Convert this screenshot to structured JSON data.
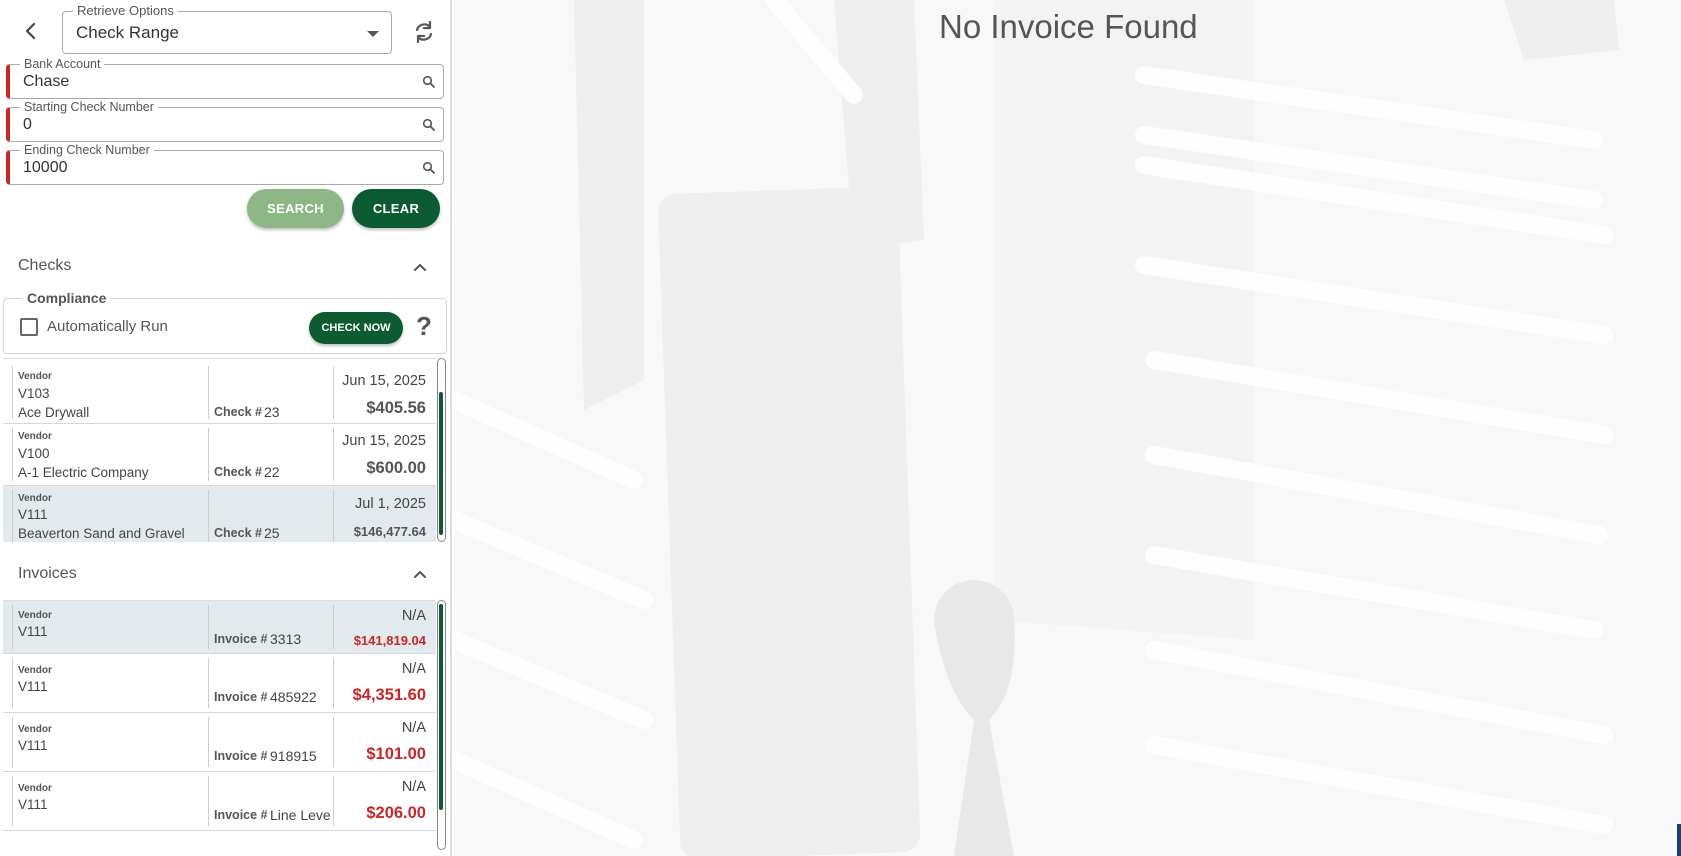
{
  "filters": {
    "retrieve_label": "Retrieve Options",
    "retrieve_value": "Check Range",
    "bank_label": "Bank Account",
    "bank_value": "Chase",
    "start_label": "Starting Check Number",
    "start_value": "0",
    "end_label": "Ending Check Number",
    "end_value": "10000",
    "search_label": "SEARCH",
    "clear_label": "CLEAR"
  },
  "checks": {
    "title": "Checks",
    "compliance": {
      "title": "Compliance",
      "auto_run_label": "Automatically Run",
      "check_now_label": "CHECK NOW",
      "help_glyph": "?"
    },
    "rows": [
      {
        "vendor_label": "Vendor",
        "vendor_code": "V103",
        "vendor_name": "Ace Drywall",
        "num_label": "Check #",
        "num": "23",
        "date": "Jun 15, 2025",
        "amount": "$405.56"
      },
      {
        "vendor_label": "Vendor",
        "vendor_code": "V100",
        "vendor_name": "A-1 Electric Company",
        "num_label": "Check #",
        "num": "22",
        "date": "Jun 15, 2025",
        "amount": "$600.00"
      },
      {
        "vendor_label": "Vendor",
        "vendor_code": "V111",
        "vendor_name": "Beaverton Sand and Gravel",
        "num_label": "Check #",
        "num": "25",
        "date": "Jul 1, 2025",
        "amount": "$146,477.64"
      }
    ]
  },
  "invoices": {
    "title": "Invoices",
    "rows": [
      {
        "vendor_label": "Vendor",
        "vendor_code": "V111",
        "num_label": "Invoice #",
        "num": "3313",
        "date": "N/A",
        "amount": "$141,819.04"
      },
      {
        "vendor_label": "Vendor",
        "vendor_code": "V111",
        "num_label": "Invoice #",
        "num": "485922",
        "date": "N/A",
        "amount": "$4,351.60"
      },
      {
        "vendor_label": "Vendor",
        "vendor_code": "V111",
        "num_label": "Invoice #",
        "num": "918915",
        "date": "N/A",
        "amount": "$101.00"
      },
      {
        "vendor_label": "Vendor",
        "vendor_code": "V111",
        "num_label": "Invoice #",
        "num": "Line Leve",
        "date": "N/A",
        "amount": "$206.00"
      }
    ]
  },
  "main": {
    "empty_message": "No Invoice Found"
  },
  "colors": {
    "primary_green": "#0c5b32",
    "disabled_green": "#8db784",
    "required_red": "#c62828",
    "selected_row": "#e3eaed"
  },
  "icons": [
    "back-arrow-icon",
    "refresh-icon",
    "search-icon",
    "chevron-up-icon",
    "help-icon",
    "dropdown-caret-icon"
  ]
}
